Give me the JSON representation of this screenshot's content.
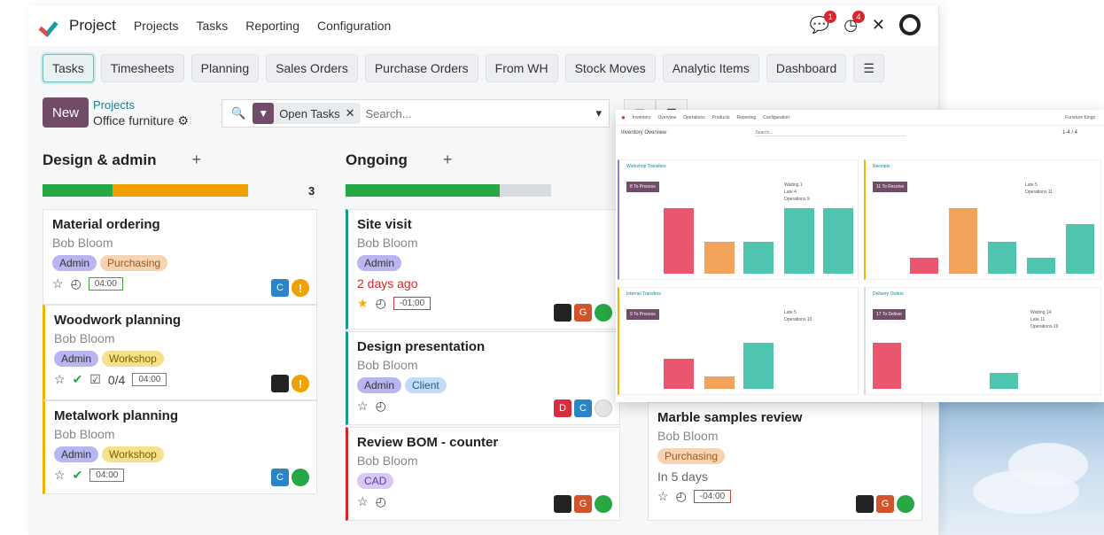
{
  "colors": {
    "brand": "#714b67",
    "green": "#28a745",
    "orange": "#f0a000",
    "teal": "#4fc4ae",
    "coral": "#e9576e",
    "peach": "#f2a35a",
    "violet": "#8e7ad9"
  },
  "nav": {
    "app": "Project",
    "menus": [
      "Projects",
      "Tasks",
      "Reporting",
      "Configuration"
    ],
    "msg_badge": "1",
    "activity_badge": "4"
  },
  "tabs": [
    "Tasks",
    "Timesheets",
    "Planning",
    "Sales Orders",
    "Purchase Orders",
    "From WH",
    "Stock Moves",
    "Analytic Items",
    "Dashboard"
  ],
  "control": {
    "new": "New",
    "bc_parent": "Projects",
    "bc_current": "Office furniture",
    "facet": "Open Tasks",
    "search_placeholder": "Search..."
  },
  "columns": [
    {
      "title": "Design & admin",
      "count": "3",
      "progress": {
        "green": 0.34,
        "orange": 0.66
      }
    },
    {
      "title": "Ongoing",
      "progress": {
        "green": 0.75,
        "grey": 0.25
      }
    }
  ],
  "cards": [
    {
      "title": "Material ordering",
      "person": "Bob Bloom",
      "tags": [
        "Admin",
        "Purchasing"
      ],
      "hours": "04:00",
      "avatar": "C"
    },
    {
      "title": "Woodwork planning",
      "person": "Bob Bloom",
      "tags": [
        "Admin",
        "Workshop"
      ],
      "hours": "04:00",
      "subtasks": "0/4"
    },
    {
      "title": "Metalwork planning",
      "person": "Bob Bloom",
      "tags": [
        "Admin",
        "Workshop"
      ],
      "hours": "04:00",
      "avatar": "C"
    },
    {
      "title": "Site visit",
      "person": "Bob Bloom",
      "tags": [
        "Admin"
      ],
      "due": "2 days ago",
      "hours": "-01:00",
      "avatar": "G"
    },
    {
      "title": "Design presentation",
      "person": "Bob Bloom",
      "tags": [
        "Admin",
        "Client"
      ],
      "avatars": [
        "D",
        "C"
      ]
    },
    {
      "title": "Review BOM - counter",
      "person": "Bob Bloom",
      "tags": [
        "CAD"
      ],
      "avatar": "G"
    },
    {
      "title": "Marble samples review",
      "person": "Bob Bloom",
      "tags": [
        "Purchasing"
      ],
      "due": "In 5 days",
      "hours": "-04:00",
      "avatar": "G"
    }
  ],
  "inventory": {
    "nav": [
      "Inventory",
      "Overview",
      "Operations",
      "Products",
      "Reporting",
      "Configuration"
    ],
    "company": "Furniture Kings",
    "title": "Inventory Overview",
    "search_placeholder": "Search...",
    "pager": "1-4 / 4",
    "panels": [
      {
        "title": "Workshop Transfers",
        "button": "8 To Process",
        "stats": [
          [
            "Waiting",
            "1"
          ],
          [
            "Late",
            "4"
          ],
          [
            "Operations",
            "9"
          ]
        ]
      },
      {
        "title": "Receipts",
        "button": "11 To Receive",
        "stats": [
          [
            "Late",
            "5"
          ],
          [
            "Operations",
            "11"
          ]
        ]
      },
      {
        "title": "Internal Transfers",
        "button": "9 To Process",
        "stats": [
          [
            "Late",
            "5"
          ],
          [
            "Operations",
            "10"
          ]
        ]
      },
      {
        "title": "Delivery Orders",
        "button": "17 To Deliver",
        "stats": [
          [
            "Waiting",
            "14"
          ],
          [
            "Late",
            "11"
          ],
          [
            "Operations",
            "19"
          ]
        ]
      }
    ]
  }
}
